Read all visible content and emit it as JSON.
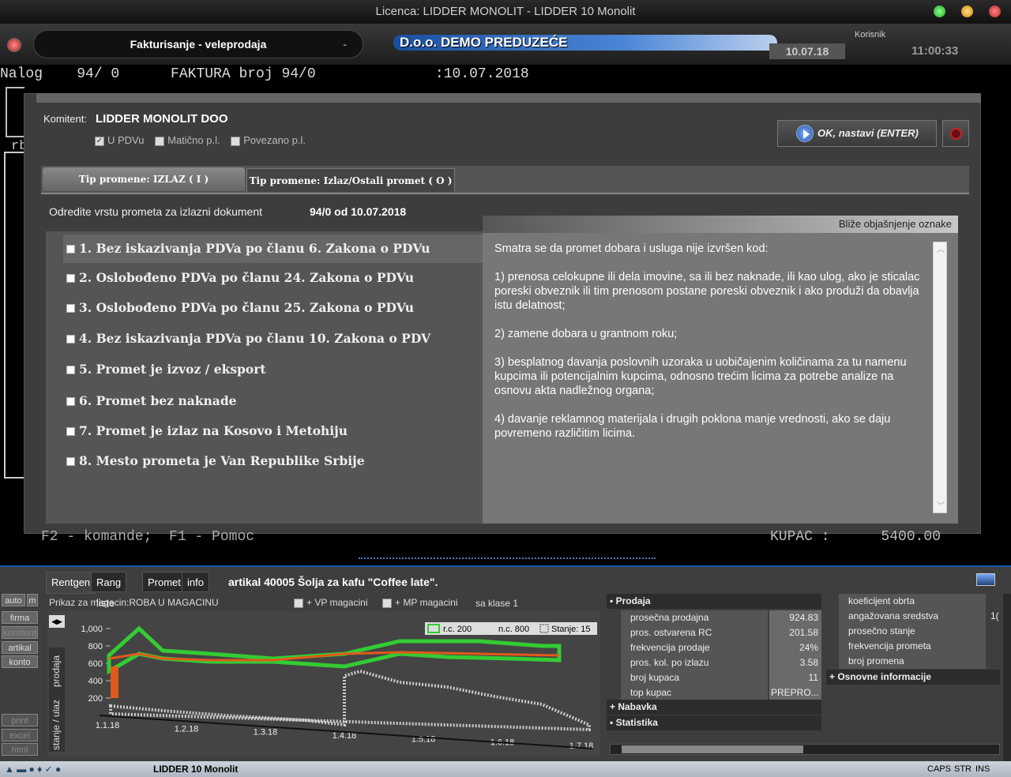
{
  "window": {
    "title": "Licenca: LIDDER MONOLIT - LIDDER 10 Monolit"
  },
  "header": {
    "module": "Fakturisanje - veleprodaja",
    "module_dash": "-",
    "company": "D.o.o. DEMO PREDUZEĆE",
    "date": "10.07.18",
    "user_label": "Korisnik",
    "time": "11:00:33"
  },
  "terminal": {
    "line": "Nalog    94/ 0      FAKTURA broj 94/0              :10.07.2018",
    "frag_rb": "rb",
    "status_left": "F2 - komande;  F1 - Pomoc",
    "status_right": "KUPAC :      5400.00"
  },
  "dialog": {
    "komitent_label": "Komitent:",
    "komitent_value": "LIDDER MONOLIT DOO",
    "checks": [
      {
        "label": "U PDVu",
        "checked": true
      },
      {
        "label": "Matično p.l.",
        "checked": false
      },
      {
        "label": "Povezano p.l.",
        "checked": false
      }
    ],
    "ok_label": "OK, nastavi (ENTER)",
    "tabs": [
      "Tip promene: IZLAZ ( I )",
      "Tip promene: Izlaz/Ostali promet ( O )"
    ],
    "instruction": "Odredite vrstu prometa za izlazni dokument",
    "doc_info": "94/0 od 10.07.2018",
    "explanation_header": "Bliže objašnjenje oznake",
    "options": [
      "1. Bez iskazivanja PDVa po članu 6. Zakona o PDVu",
      "2. Oslobođeno PDVa po članu 24. Zakona o PDVu",
      "3. Oslobođeno PDVa po članu 25. Zakona o PDVu",
      "4. Bez iskazivanja PDVa po članu 10. Zakona o PDV",
      "5. Promet je izvoz / eksport",
      "6. Promet bez naknade",
      "7. Promet je izlaz na Kosovo i Metohiju",
      "8. Mesto prometa je Van Republike Srbije"
    ],
    "explanation": "Smatra se da promet dobara i usluga nije izvršen kod:\n\n1) prenosa celokupne ili dela imovine, sa ili bez naknade, ili kao ulog, ako je sticalac poreski obveznik ili tim prenosom postane poreski obveznik i ako produži da obavlja istu delatnost;\n\n2) zamene dobara u grantnom roku;\n\n3) besplatnog davanja poslovnih uzoraka u uobičajenim količinama za tu namenu kupcima ili potencijalnim kupcima, odnosno trećim licima za potrebe analize na osnovu akta nadležnog organa;\n\n4) davanje reklamnog materijala i drugih poklona manje vrednosti, ako se daju povremeno različitim licima."
  },
  "lower": {
    "tabs": [
      "Rentgen",
      "Rang liste",
      "Promet",
      "info"
    ],
    "artikal": "artikal 40005 Šolja za kafu \"Coffee late\".",
    "sidebar": [
      "auto",
      "m",
      "firma",
      "komitent",
      "artikal",
      "konto",
      "print",
      "excel",
      "html"
    ],
    "prikaz": "Prikaz za magacin:ROBA U MAGACINU",
    "vp": "+ VP magacini",
    "mp": "+ MP magacini",
    "klase": "sa klase 1",
    "side_labels": [
      "prodaja",
      "stanje / ulaz"
    ],
    "legend": [
      "r.c. 200",
      "n.c. 800",
      "Stanje: 15"
    ],
    "prodaja_header": "Prodaja",
    "prodaja_rows": [
      {
        "label": "prosečna prodajna",
        "value": "924.83"
      },
      {
        "label": "pros. ostvarena RC",
        "value": "201.58"
      },
      {
        "label": "frekvencija prodaje",
        "value": "24%"
      },
      {
        "label": "pros. kol. po izlazu",
        "value": "3.58"
      },
      {
        "label": "broj kupaca",
        "value": "11"
      },
      {
        "label": "top kupac",
        "value": "PREPRO..."
      }
    ],
    "nabavka": "Nabavka",
    "statistika": "Statistika",
    "right_rows": [
      "koeficijent obrta",
      "angažovana sredstva",
      "prosečno stanje",
      "frekvencija prometa",
      "broj promena"
    ],
    "right_value_partial": "1(",
    "osnovne": "Osnovne informacije"
  },
  "chart_data": {
    "type": "line",
    "x_ticks": [
      "1.1.18",
      "1.2.18",
      "1.3.18",
      "1.4.18",
      "1.5.18",
      "1.6.18",
      "1.7.18"
    ],
    "y_ticks": [
      "1,000",
      "800",
      "600",
      "400",
      "200"
    ],
    "ylim": [
      0,
      1000
    ],
    "series": [
      {
        "name": "r.c. 200",
        "color": "#4de04d"
      },
      {
        "name": "n.c. 800",
        "color": "#e05a1a"
      },
      {
        "name": "Stanje: 15",
        "color": "#cccccc"
      }
    ]
  },
  "taskbar": {
    "app": "LIDDER 10 Monolit",
    "caps": "CAPS",
    "str": "STR",
    "ins": "INS"
  }
}
